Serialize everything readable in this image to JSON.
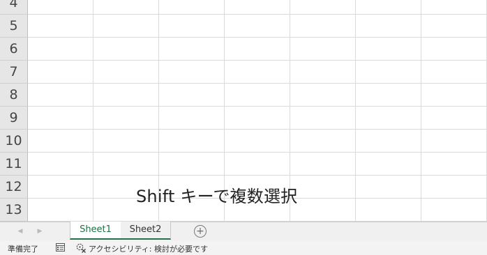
{
  "rows": [
    {
      "num": "4"
    },
    {
      "num": "5"
    },
    {
      "num": "6"
    },
    {
      "num": "7"
    },
    {
      "num": "8"
    },
    {
      "num": "9"
    },
    {
      "num": "10"
    },
    {
      "num": "11"
    },
    {
      "num": "12"
    },
    {
      "num": "13"
    }
  ],
  "caption": "Shift キーで複数選択",
  "tabs": [
    {
      "label": "Sheet1",
      "active": true
    },
    {
      "label": "Sheet2",
      "active": false
    }
  ],
  "status": {
    "ready": "準備完了",
    "accessibility": "アクセシビリティ: 検討が必要です"
  },
  "icons": {
    "scroll_left": "tab-scroll-left-icon",
    "scroll_right": "tab-scroll-right-icon",
    "add_sheet": "plus-circle-icon",
    "macro": "macro-record-icon",
    "accessibility": "accessibility-check-icon"
  },
  "colors": {
    "active_tab_text": "#1e7145",
    "active_tab_underline": "#217346",
    "row_header_bg": "#e6e6e6",
    "gridline": "#dadada"
  }
}
